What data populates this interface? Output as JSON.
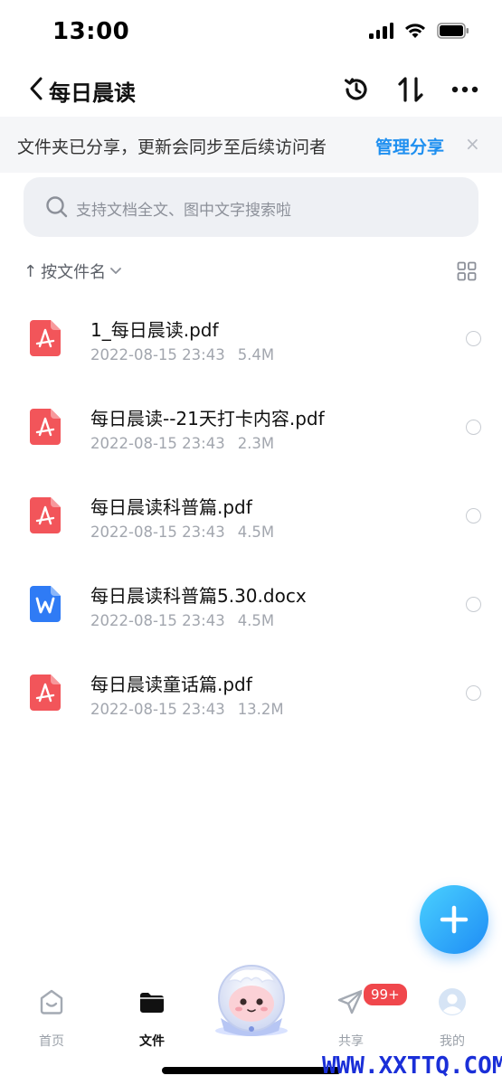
{
  "status_bar": {
    "time": "13:00"
  },
  "nav": {
    "title": "每日晨读"
  },
  "share_banner": {
    "text": "文件夹已分享，更新会同步至后续访问者",
    "action": "管理分享",
    "close": "×"
  },
  "search": {
    "placeholder": "支持文档全文、图中文字搜索啦"
  },
  "sort": {
    "label": "按文件名",
    "arrow": "↑"
  },
  "files": [
    {
      "name": "1_每日晨读.pdf",
      "date": "2022-08-15 23:43",
      "size": "5.4M",
      "type": "pdf"
    },
    {
      "name": "每日晨读--21天打卡内容.pdf",
      "date": "2022-08-15 23:43",
      "size": "2.3M",
      "type": "pdf"
    },
    {
      "name": "每日晨读科普篇.pdf",
      "date": "2022-08-15 23:43",
      "size": "4.5M",
      "type": "pdf"
    },
    {
      "name": "每日晨读科普篇5.30.docx",
      "date": "2022-08-15 23:43",
      "size": "4.5M",
      "type": "docx"
    },
    {
      "name": "每日晨读童话篇.pdf",
      "date": "2022-08-15 23:43",
      "size": "13.2M",
      "type": "pdf"
    }
  ],
  "tabs": [
    {
      "label": "首页",
      "icon": "home-icon"
    },
    {
      "label": "文件",
      "icon": "folder-icon",
      "active": true
    },
    {
      "label": "共享",
      "icon": "paper-plane-icon"
    },
    {
      "label": "我的",
      "icon": "avatar-icon"
    }
  ],
  "share_badge": "99+",
  "watermark": "WWW.XXTTQ.COM",
  "colors": {
    "accent": "#1e8ff0",
    "pdf": "#f2555a",
    "docx": "#2f7bf5",
    "badge": "#f0474c"
  }
}
